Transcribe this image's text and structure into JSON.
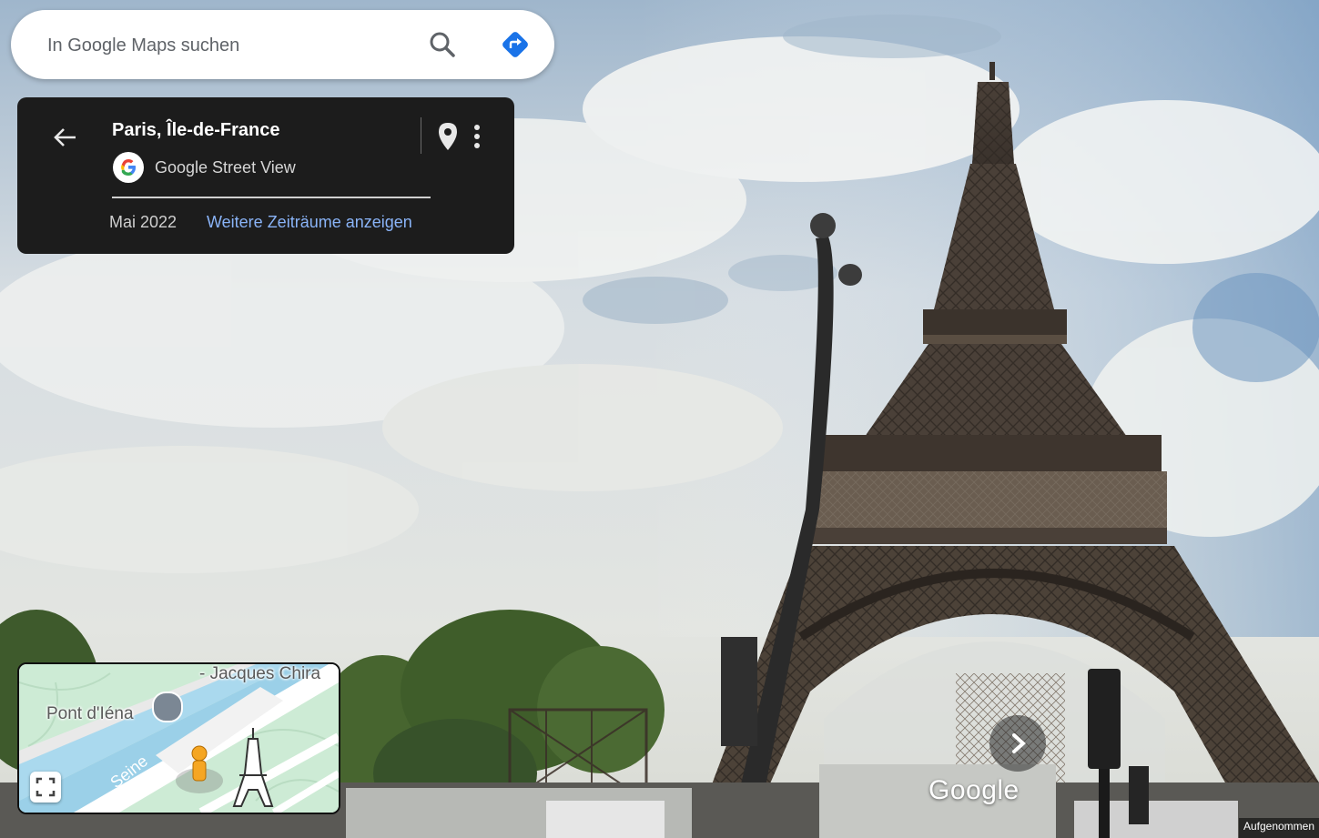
{
  "search": {
    "placeholder": "In Google Maps suchen",
    "value": ""
  },
  "icons": {
    "search": "search-icon",
    "directions": "directions-icon",
    "back": "arrow-left-icon",
    "pin": "map-pin-icon",
    "more": "more-vert-icon",
    "google_logo": "google-g-logo",
    "fullscreen": "fullscreen-icon",
    "bridge": "bridge-icon",
    "pegman": "pegman-icon",
    "landmark": "eiffel-tower-icon",
    "next": "chevron-right-icon"
  },
  "info_card": {
    "title": "Paris, Île-de-France",
    "provider": "Google Street View",
    "date": "Mai 2022",
    "more_dates_link": "Weitere Zeiträume anzeigen"
  },
  "minimap": {
    "road_label": "- Jacques Chira",
    "bridge_label": "Pont d'Iéna",
    "river_label": "Seine"
  },
  "watermark": "Google",
  "footer_note": "Aufgenommen",
  "colors": {
    "card_bg": "#1c1c1c",
    "link": "#8ab4f8",
    "directions_blue": "#1a73e8",
    "pegman_orange": "#f5a623"
  }
}
